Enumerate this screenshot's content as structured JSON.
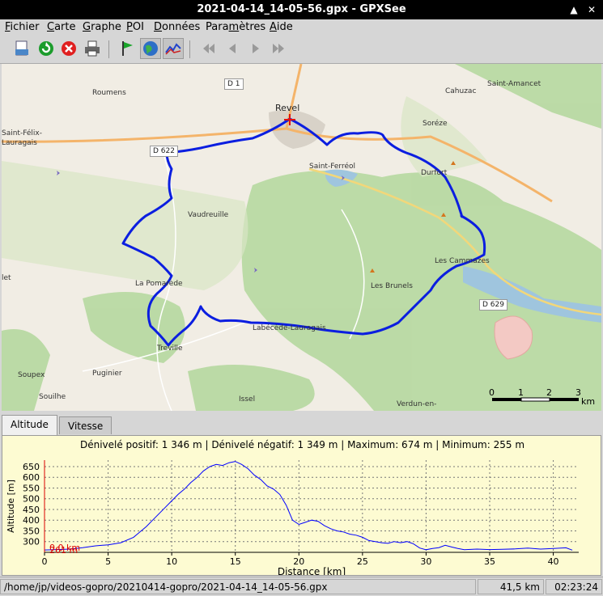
{
  "window": {
    "title": "2021-04-14_14-05-56.gpx - GPXSee",
    "close_glyph": "✕",
    "max_glyph": "▲"
  },
  "menu": [
    {
      "label": "Fichier",
      "u": "F",
      "rest": "ichier"
    },
    {
      "label": "Carte",
      "u": "C",
      "rest": "arte"
    },
    {
      "label": "Graphe",
      "u": "G",
      "rest": "raphe"
    },
    {
      "label": "POI",
      "u": "P",
      "rest": "OI"
    },
    {
      "label": "Données",
      "u": "D",
      "rest": "onnées"
    },
    {
      "label": "Paramètres",
      "pre": "Para",
      "u": "m",
      "rest": "ètres"
    },
    {
      "label": "Aide",
      "u": "A",
      "rest": "ide"
    }
  ],
  "toolbar": [
    "open-file",
    "reload",
    "close-file",
    "print",
    "show-poi",
    "show-map",
    "show-graph",
    "first",
    "previous",
    "next",
    "last"
  ],
  "map": {
    "places": [
      {
        "name": "Revel",
        "big": true
      },
      {
        "name": "Roumens"
      },
      {
        "name": "Soréze"
      },
      {
        "name": "Cahuzac"
      },
      {
        "name": "Saint-Amancet"
      },
      {
        "name": "Saint-Félix-"
      },
      {
        "name": "Lauragais"
      },
      {
        "name": "Saint-Ferréol"
      },
      {
        "name": "Durfort"
      },
      {
        "name": "Vaudreuille"
      },
      {
        "name": "Les Cammazes"
      },
      {
        "name": "La Pomarède"
      },
      {
        "name": "Les Brunels"
      },
      {
        "name": "Labécède-Lauragais"
      },
      {
        "name": "Treville"
      },
      {
        "name": "Soupex"
      },
      {
        "name": "Puginier"
      },
      {
        "name": "Souilhe"
      },
      {
        "name": "Issel"
      },
      {
        "name": "Verdun-en-"
      },
      {
        "name": "let"
      }
    ],
    "roads": [
      "D 1",
      "D 622",
      "D 629"
    ],
    "scale": {
      "ticks": [
        "0",
        "1",
        "2",
        "3"
      ],
      "unit": "km"
    }
  },
  "tabs": [
    {
      "label": "Altitude",
      "active": true
    },
    {
      "label": "Vitesse",
      "active": false
    }
  ],
  "graph": {
    "info": "Dénivelé positif: 1 346 m | Dénivelé négatif: 1 349 m | Maximum: 674 m | Minimum: 255 m",
    "slider_alt": "261 m",
    "slider_dist": "0,0 km"
  },
  "chart_data": {
    "type": "line",
    "title": "",
    "xlabel": "Distance [km]",
    "ylabel": "Altitude [m]",
    "xlim": [
      0,
      42
    ],
    "ylim": [
      250,
      680
    ],
    "xticks": [
      0,
      5,
      10,
      15,
      20,
      25,
      30,
      35,
      40
    ],
    "yticks": [
      300,
      350,
      400,
      450,
      500,
      550,
      600,
      650
    ],
    "grid": true,
    "series": [
      {
        "name": "",
        "color": "#0000ff",
        "x": [
          0,
          1,
          2,
          3,
          4,
          5,
          6,
          7,
          7.5,
          8,
          8.5,
          9,
          9.5,
          10,
          10.5,
          11,
          11.5,
          12,
          12.5,
          13,
          13.5,
          14,
          14.5,
          15,
          15.5,
          16,
          16.5,
          17,
          17.5,
          18,
          18.5,
          19,
          19.5,
          20,
          20.5,
          21,
          21.5,
          22,
          22.5,
          23,
          23.5,
          24,
          24.5,
          25,
          25.5,
          26,
          26.5,
          27,
          27.5,
          28,
          28.5,
          29,
          29.5,
          30,
          30.5,
          31,
          31.5,
          32,
          32.5,
          33,
          34,
          35,
          36,
          37,
          38,
          39,
          40,
          41,
          41.5
        ],
        "y": [
          261,
          263,
          265,
          272,
          280,
          285,
          295,
          320,
          345,
          370,
          400,
          430,
          460,
          490,
          520,
          545,
          575,
          600,
          630,
          650,
          660,
          655,
          668,
          674,
          660,
          640,
          610,
          590,
          560,
          545,
          520,
          470,
          400,
          380,
          390,
          400,
          395,
          375,
          360,
          350,
          345,
          335,
          330,
          320,
          305,
          300,
          295,
          292,
          300,
          295,
          300,
          290,
          270,
          262,
          268,
          272,
          283,
          275,
          268,
          262,
          265,
          263,
          264,
          266,
          270,
          265,
          268,
          271,
          260
        ]
      }
    ]
  },
  "status": {
    "path": "/home/jp/videos-gopro/20210414-gopro/2021-04-14_14-05-56.gpx",
    "distance": "41,5 km",
    "time": "02:23:24"
  }
}
